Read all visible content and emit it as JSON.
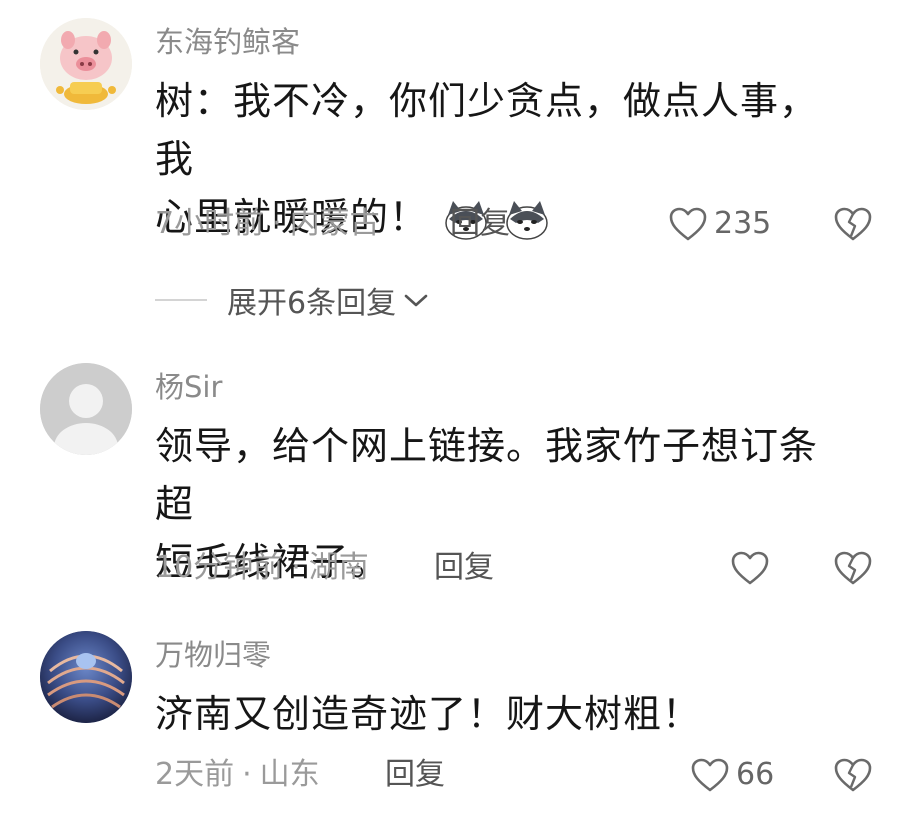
{
  "comments": [
    {
      "username": "东海钓鲸客",
      "text_line1": "树：我不冷，你们少贪点，做点人事，我",
      "text_line2": "心里就暖暖的！",
      "emoji": "husky-emoji",
      "time": "7小时前",
      "location": "内蒙古",
      "reply_label": "回复",
      "likes": "235",
      "expand_label": "展开6条回复"
    },
    {
      "username": "杨Sir",
      "text_line1": "领导，给个网上链接。我家竹子想订条超",
      "text_line2": "短毛线裙子。",
      "time": "10分钟前",
      "location": "湖南",
      "reply_label": "回复",
      "likes": ""
    },
    {
      "username": "万物归零",
      "text_line1": "济南又创造奇迹了！财大树粗！",
      "time": "2天前",
      "location": "山东",
      "reply_label": "回复",
      "likes": "66"
    }
  ],
  "separator": "·",
  "colors": {
    "text": "#161616",
    "meta": "#9a9a9a",
    "username": "#8a8a8a"
  }
}
